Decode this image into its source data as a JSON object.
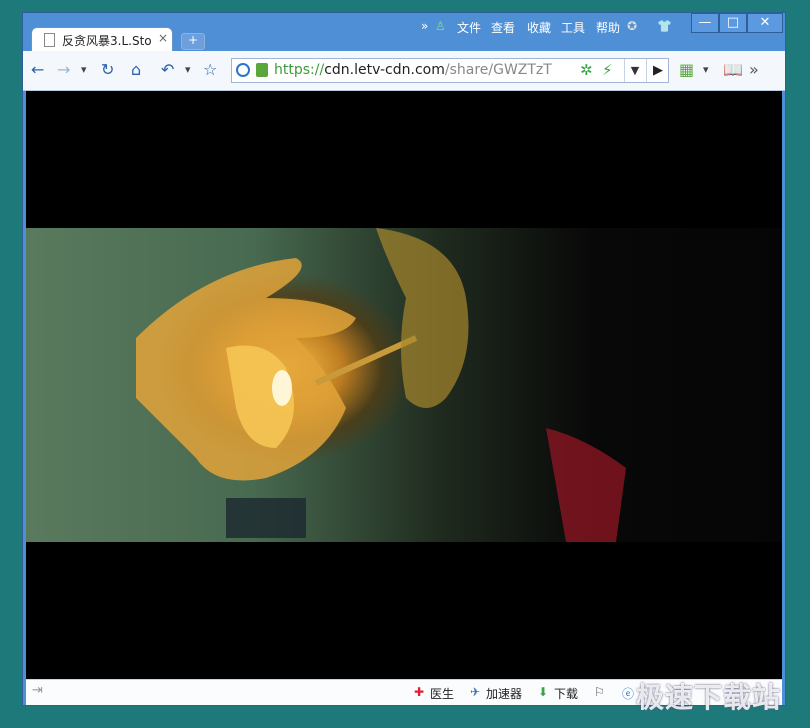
{
  "tab": {
    "title": "反贪风暴3.L.Sto",
    "close": "×"
  },
  "newtab": "+",
  "menu": {
    "chevron": "»",
    "items": [
      "文件",
      "查看",
      "收藏",
      "工具",
      "帮助"
    ]
  },
  "window_buttons": {
    "minimize": "—",
    "maximize": "□",
    "close": "✕"
  },
  "toolbar": {
    "back": "←",
    "forward": "→",
    "dropdown": "▾",
    "refresh": "↻",
    "home": "⌂",
    "undo": "↶",
    "undo_dropdown": "▾",
    "star": "☆",
    "more": "»"
  },
  "address": {
    "scheme": "https://",
    "host": "cdn.letv-cdn.com",
    "path": "/share/GWZTzT"
  },
  "statusbar": {
    "doctor": "医生",
    "accelerator": "加速器",
    "download": "下载"
  },
  "watermark": "极速下载站"
}
